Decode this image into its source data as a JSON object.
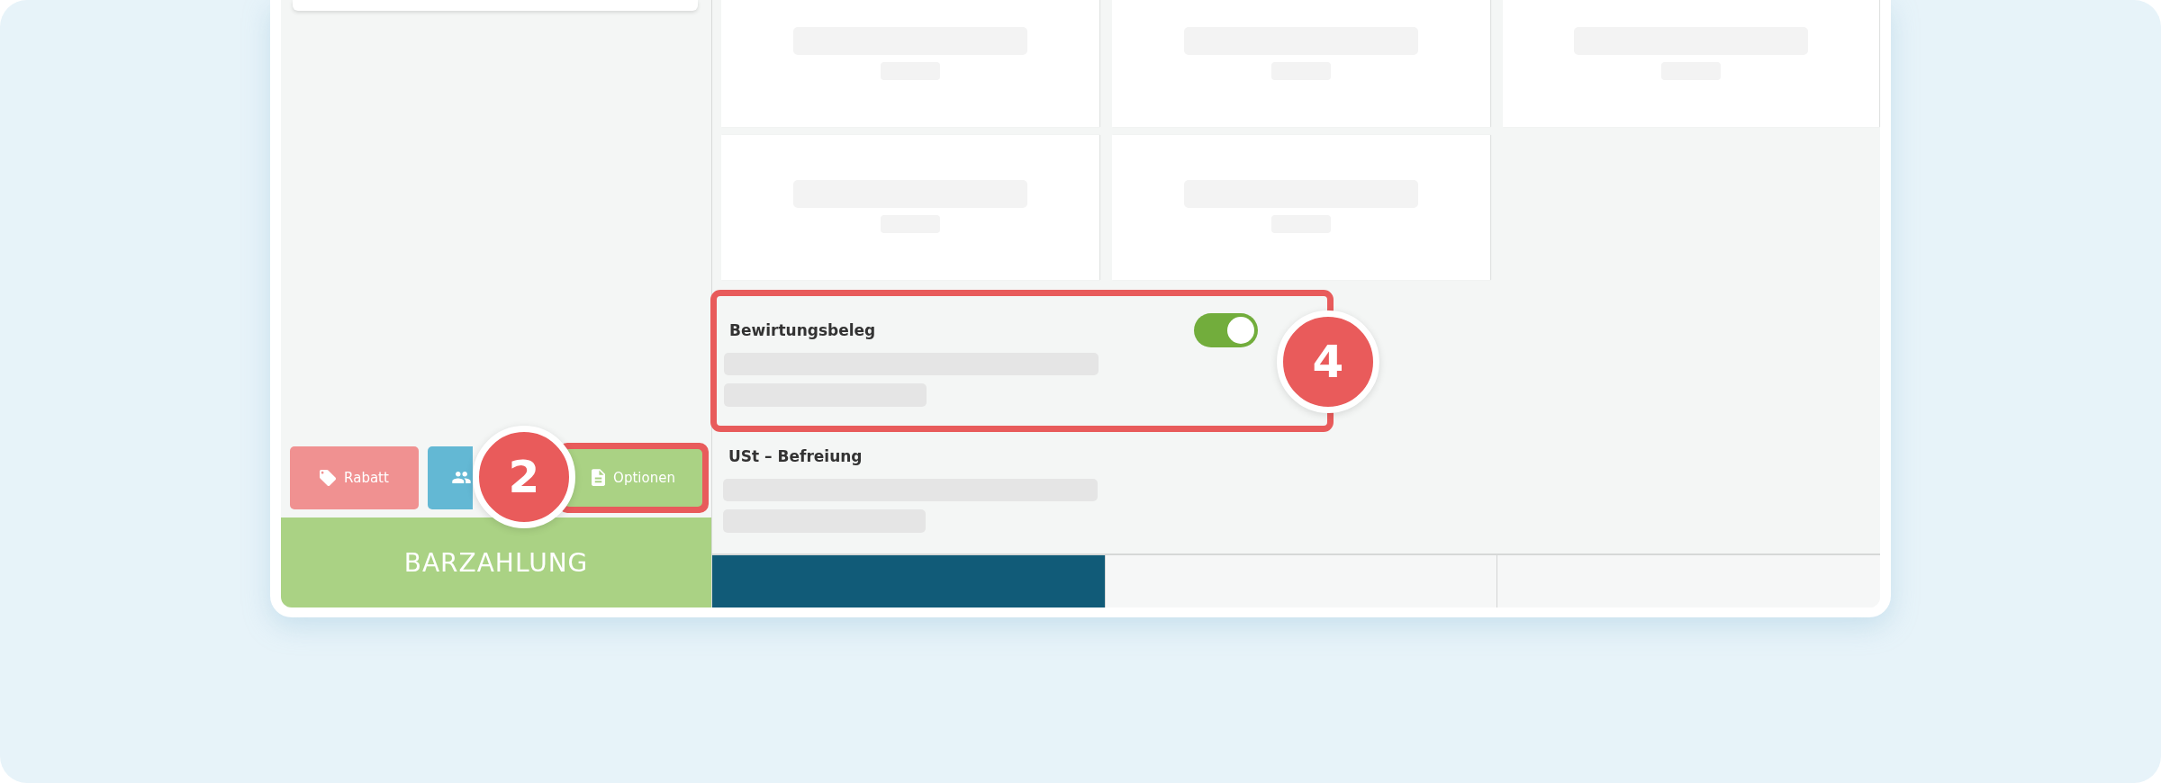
{
  "left_panel": {
    "buttons": [
      {
        "kind": "discount",
        "label": "Rabatt",
        "color": "#f09191",
        "highlighted": false
      },
      {
        "kind": "customer",
        "color": "#63b8d4",
        "highlighted": false
      },
      {
        "kind": "options",
        "label": "Optionen",
        "color": "#aad284",
        "highlighted": true,
        "callout": "2"
      }
    ],
    "pay_button": {
      "label": "BARZAHLUNG"
    }
  },
  "options": [
    {
      "kind": "toggle",
      "title": "Bewirtungsbeleg",
      "on": true,
      "highlighted": true,
      "callout": "4"
    },
    {
      "kind": "plain",
      "title": "USt – Befreiung",
      "highlighted": false
    }
  ],
  "bottom_tabs": [
    {
      "selected": true
    },
    {
      "selected": false
    },
    {
      "selected": false
    }
  ]
}
